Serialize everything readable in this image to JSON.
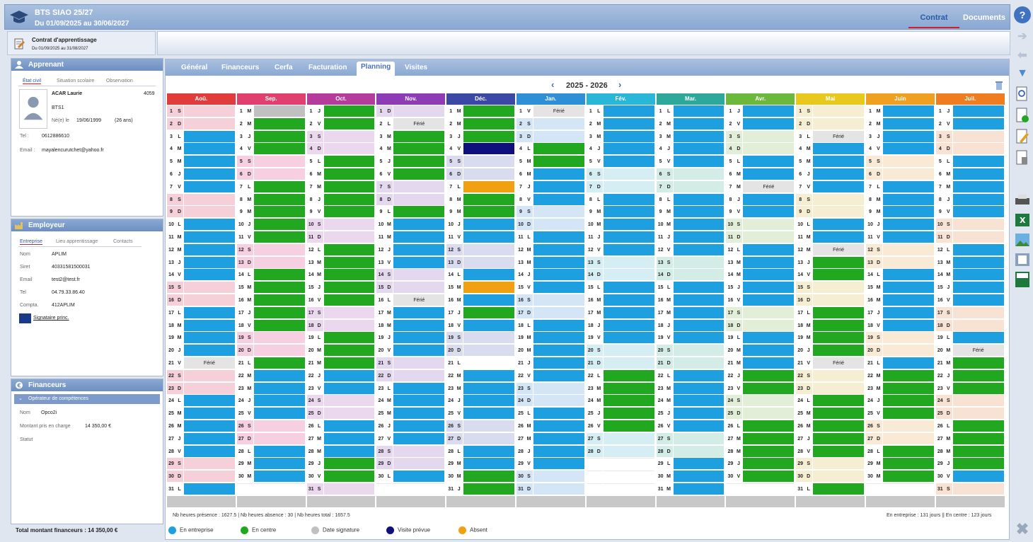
{
  "header": {
    "title": "BTS SIAO 25/27",
    "dates": "Du 01/09/2025 au 30/06/2027",
    "tab_contrat": "Contrat",
    "tab_documents": "Documents"
  },
  "subbar": {
    "title": "Contrat d'apprentissage",
    "dates": "Du 01/09/2025 au 31/08/2027"
  },
  "apprenant": {
    "header": "Apprenant",
    "tabs": [
      "État civil",
      "Situation scolaire",
      "Observation"
    ],
    "name": "ACAR Laurie",
    "id": "4059",
    "class": "BTS1",
    "born_label": "Né(e) le",
    "born": "19/06/1999",
    "age": "(26 ans)",
    "tel_label": "Tel :",
    "tel": "0612886610",
    "email_label": "Email :",
    "email": "mayalencurutchet@yahoo.fr"
  },
  "employeur": {
    "header": "Employeur",
    "tabs": [
      "Entreprise",
      "Lieu apprentissage",
      "Contacts"
    ],
    "nom_label": "Nom",
    "nom": "APLIM",
    "siret_label": "Siret",
    "siret": "40331581500031",
    "email_label": "Email",
    "email": "test2@test.fr",
    "tel_label": "Tel",
    "tel": "04.79.33.86.40",
    "compta_label": "Compta.",
    "compta": "412APLIM",
    "signataire": "Signataire princ."
  },
  "financeurs": {
    "header": "Financeurs",
    "sub": "Opérateur de compétences",
    "nom_label": "Nom",
    "nom": "Opco2i",
    "montant_label": "Montant pris en charge",
    "montant": "14 350,00 €",
    "statut_label": "Statut",
    "total": "Total montant financeurs : 14 350,00 €"
  },
  "tabs": [
    "Général",
    "Financeurs",
    "Cerfa",
    "Facturation",
    "Planning",
    "Visites"
  ],
  "year": "2025 - 2026",
  "months": [
    {
      "name": "Aoû.",
      "color": "#e03c3c",
      "light": "#f6d0d8",
      "start": 5,
      "days": 31
    },
    {
      "name": "Sep.",
      "color": "#e0406e",
      "light": "#f6d0e0",
      "start": 1,
      "days": 30
    },
    {
      "name": "Oct.",
      "color": "#b63c9c",
      "light": "#ecd8ee",
      "start": 3,
      "days": 31
    },
    {
      "name": "Nov.",
      "color": "#8e3cb6",
      "light": "#e4d8ee",
      "start": 6,
      "days": 30
    },
    {
      "name": "Déc.",
      "color": "#3c48a6",
      "light": "#d8dcee",
      "start": 1,
      "days": 31
    },
    {
      "name": "Jan.",
      "color": "#2e8ed6",
      "light": "#d4e6f6",
      "start": 4,
      "days": 31
    },
    {
      "name": "Fév.",
      "color": "#2ab6d6",
      "light": "#d4eef4",
      "start": 0,
      "days": 28
    },
    {
      "name": "Mar.",
      "color": "#2ea89a",
      "light": "#d4ece6",
      "start": 0,
      "days": 31
    },
    {
      "name": "Avr.",
      "color": "#6cb83c",
      "light": "#e2eed8",
      "start": 3,
      "days": 30
    },
    {
      "name": "Mai",
      "color": "#e8c81c",
      "light": "#f6eed2",
      "start": 5,
      "days": 31
    },
    {
      "name": "Juin",
      "color": "#f0a020",
      "light": "#f8ead4",
      "start": 1,
      "days": 30
    },
    {
      "name": "Juil.",
      "color": "#f07c20",
      "light": "#f8e2d4",
      "start": 3,
      "days": 31
    }
  ],
  "day_letters": [
    "L",
    "M",
    "M",
    "J",
    "V",
    "S",
    "D"
  ],
  "ferie_label": "Férié",
  "plan": [
    "EEEEEEEEEEEEEEFEEEEEEEEEEEECCCE",
    "GCCCCCCCCCCCCCCEEEEEEEECCCCCCC",
    "CCCCCCCCCCCCCCCEEEEECCCCCCCCCCC",
    "FCCCCCEEEEFEEEEEEEEEEECCCCCCCCC",
    "CCCNACCEEEAECEOEEEEEECCCFCCCCCCC",
    "FCCEEEEEEEEEEEEEEEEEECCCCCEEEEEEE",
    "EEEEEEEEEEEEEEECCCCCCCEEEECCCC",
    "EEEEEEEEEEEEEEEEEEEEEEEEEEEEEEE",
    "EEEEFEEEEEEEEEECCCCCCCCCCCCCCC",
    "FEEEEEEFCCCCCCFCCCCCCCCCCCEEEEE",
    "EEEEEEEEEEEEEEECCCCCCCCCCCCEEE",
    "EEEEEEEEEEEEEFCCCCCCCEEEEEEEEEE"
  ],
  "footer_left": "Nb heures présence : 1627.5 | Nb heures absence : 30 | Nb heures total : 1657.5",
  "footer_right": "En entreprise : 131 jours || En centre : 123 jours",
  "legend": [
    {
      "label": "En entreprise",
      "color": "#1ea0e0"
    },
    {
      "label": "En centre",
      "color": "#22a820"
    },
    {
      "label": "Date signature",
      "color": "#c0c0c0"
    },
    {
      "label": "Visite prévue",
      "color": "#10107a"
    },
    {
      "label": "Absent",
      "color": "#f0a010"
    }
  ],
  "colors": {
    "entreprise": "#1ea0e0",
    "centre": "#22a820",
    "signature": "#c0c0c0",
    "visite": "#10107a",
    "absent": "#f0a010"
  }
}
